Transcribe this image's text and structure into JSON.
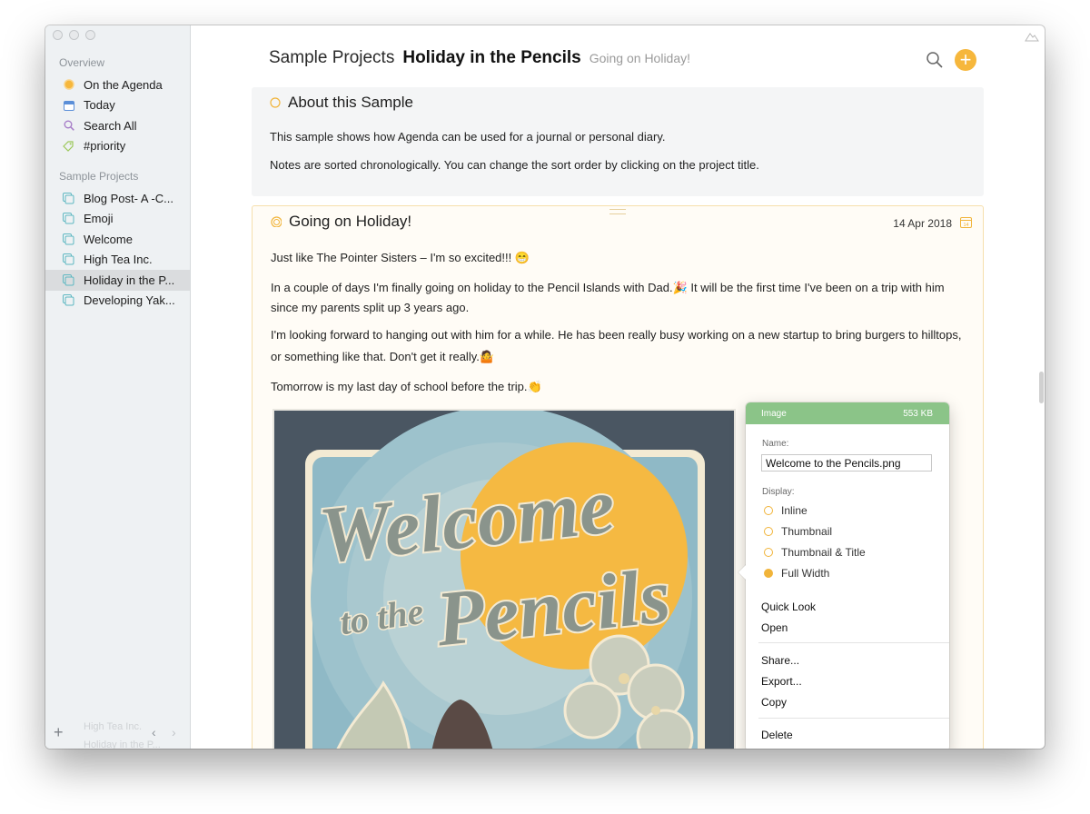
{
  "sidebar": {
    "overview_title": "Overview",
    "overview_items": [
      {
        "label": "On the Agenda",
        "icon": "agenda-dot-icon"
      },
      {
        "label": "Today",
        "icon": "calendar-icon"
      },
      {
        "label": "Search All",
        "icon": "search-icon"
      },
      {
        "label": "#priority",
        "icon": "tag-icon"
      }
    ],
    "projects_title": "Sample Projects",
    "project_items": [
      {
        "label": "Blog Post- A -C..."
      },
      {
        "label": "Emoji"
      },
      {
        "label": "Welcome"
      },
      {
        "label": "High Tea Inc."
      },
      {
        "label": "Holiday in the P...",
        "selected": true
      },
      {
        "label": "Developing Yak..."
      }
    ],
    "bottom": {
      "add": "+",
      "prev": "‹",
      "next": "›"
    },
    "ghost_lines": [
      "High Tea Inc.",
      "Holiday in the P..."
    ]
  },
  "header": {
    "category": "Sample Projects",
    "project": "Holiday in the Pencils",
    "subtitle": "Going on Holiday!",
    "add_symbol": "+"
  },
  "notes": [
    {
      "title": "About this Sample",
      "paragraphs": [
        "This sample shows how Agenda can be used for a journal or personal diary.",
        "Notes are sorted chronologically. You can change the sort order by clicking on the project title."
      ]
    },
    {
      "title": "Going on Holiday!",
      "date": "14 Apr 2018",
      "paragraphs": [
        "Just like The Pointer Sisters – I'm so excited!!! 😁",
        "In a couple of days I'm finally going on holiday to the Pencil Islands with Dad.🎉 It will be the first time I've been on a trip with him",
        "since my parents split up 3 years ago.",
        "I'm looking forward to hanging out with him for a while. He has been really busy working on a new startup to bring burgers to hilltops,",
        "or something like that. Don't get it really.🤷",
        "Tomorrow is my last day of school before the trip.👏"
      ],
      "image": {
        "line1": "Welcome",
        "line2a": "to the",
        "line2b": "Pencils"
      }
    }
  ],
  "popover": {
    "header_left": "Image",
    "header_right": "553 KB",
    "name_label": "Name:",
    "name_value": "Welcome to the Pencils.png",
    "display_label": "Display:",
    "display_options": [
      {
        "label": "Inline",
        "selected": false
      },
      {
        "label": "Thumbnail",
        "selected": false
      },
      {
        "label": "Thumbnail & Title",
        "selected": false
      },
      {
        "label": "Full Width",
        "selected": true
      }
    ],
    "actions_1": [
      "Quick Look",
      "Open"
    ],
    "actions_2": [
      "Share...",
      "Export...",
      "Copy"
    ],
    "actions_3": [
      "Delete"
    ]
  },
  "colors": {
    "accent": "#f6b73c",
    "popover_header": "#8bc488",
    "sidebar_bg": "#eef1f3",
    "note_border": "#f6dfac"
  }
}
